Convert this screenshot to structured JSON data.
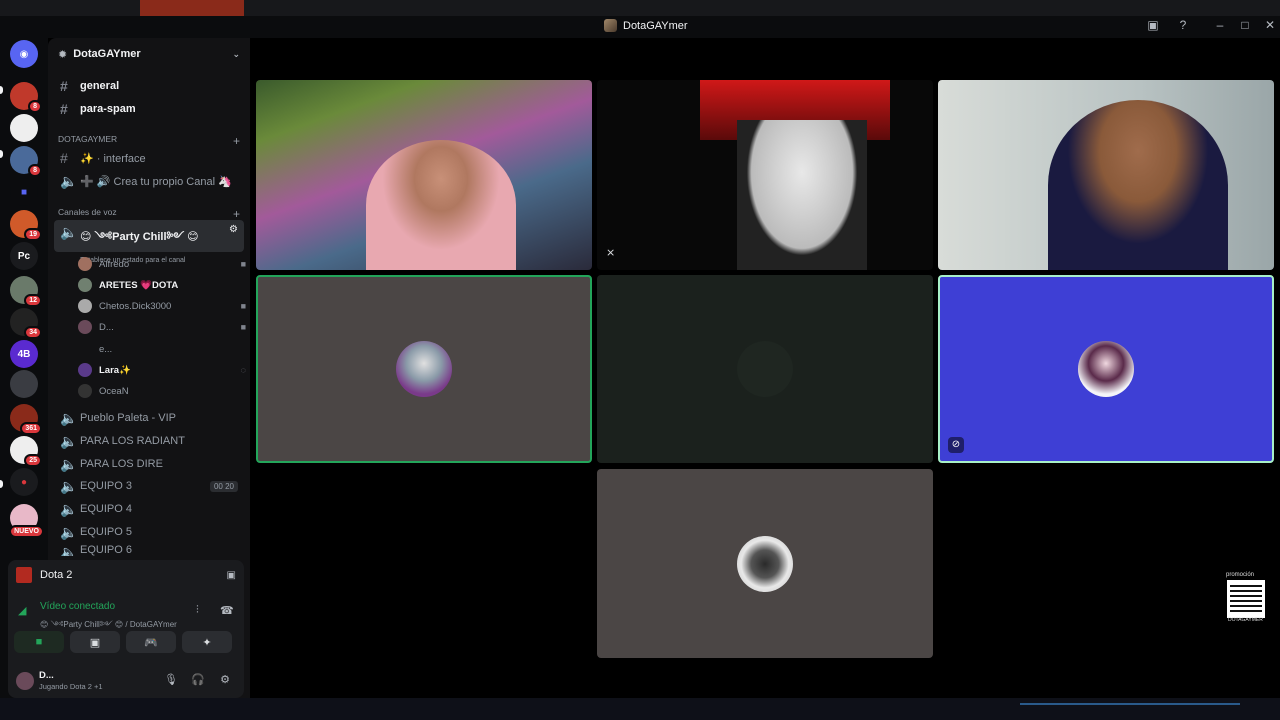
{
  "window": {
    "title": "DotaGAYmer"
  },
  "rail": {
    "servers": [
      {
        "label": "",
        "badge": "8"
      },
      {
        "label": "",
        "badge": ""
      },
      {
        "label": "",
        "badge": "8"
      },
      {
        "label": "",
        "badge": ""
      },
      {
        "label": "",
        "badge": "19"
      },
      {
        "label": "Pc",
        "badge": ""
      },
      {
        "label": "",
        "badge": "12"
      },
      {
        "label": "",
        "badge": "34"
      },
      {
        "label": "4B",
        "badge": ""
      },
      {
        "label": "",
        "badge": ""
      },
      {
        "label": "",
        "badge": "361"
      },
      {
        "label": "",
        "badge": "25"
      },
      {
        "label": "",
        "badge": ""
      },
      {
        "label": "",
        "badge": "NUEVO"
      }
    ]
  },
  "sidebar": {
    "server_name": "DotaGAYmer",
    "text_channels": [
      {
        "name": "general"
      },
      {
        "name": "para-spam"
      }
    ],
    "category_server": "DOTAGAYMER",
    "server_channels": [
      {
        "name": "✨ · interface"
      },
      {
        "name": "➕ 🔊 Crea tu propio Canal 🦄"
      }
    ],
    "category_voice": "Canales de voz",
    "active_voice": {
      "name": "😊 ༺Party Chill༻ 😊",
      "status": "Establece un estado para el canal"
    },
    "voice_users": [
      {
        "name": "Alfredo"
      },
      {
        "name": "ARETES 💗DOTA"
      },
      {
        "name": "Chetos.Dick3000"
      },
      {
        "name": "D..."
      },
      {
        "name": "e..."
      },
      {
        "name": "Lara✨"
      },
      {
        "name": "OceaN"
      }
    ],
    "voice_channels": [
      {
        "name": "Pueblo Paleta - VIP",
        "counts": ""
      },
      {
        "name": "PARA LOS RADIANT",
        "counts": ""
      },
      {
        "name": "PARA LOS DIRE",
        "counts": ""
      },
      {
        "name": "EQUIPO 3",
        "counts": "00 20"
      },
      {
        "name": "EQUIPO 4",
        "counts": ""
      },
      {
        "name": "EQUIPO 5",
        "counts": ""
      },
      {
        "name": "EQUIPO 6",
        "counts": ""
      }
    ]
  },
  "game_activity": {
    "name": "Dota 2"
  },
  "voice_panel": {
    "status": "Vídeo conectado",
    "channel": "😊 ༺Party Chill༻ 😊 / DotaGAYmer"
  },
  "user": {
    "name": "D...",
    "status": "Jugando Dota 2 +1"
  },
  "overlay": {
    "qr_label": "promoción",
    "qr_sub": "DOTAGAYMER"
  },
  "colors": {
    "speaking_border": "#23a55a",
    "tile_blue": "#3e3fd5",
    "connected_green": "#23a55a"
  }
}
